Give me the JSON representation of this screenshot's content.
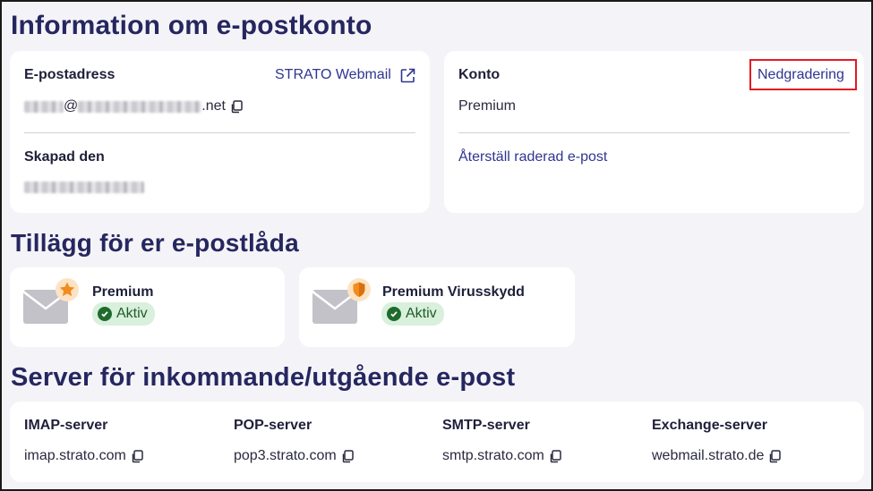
{
  "headings": {
    "account_info": "Information om e-postkonto",
    "addons": "Tillägg för er e-postlåda",
    "servers": "Server för inkommande/utgående e-post"
  },
  "email_card": {
    "email_label": "E-postadress",
    "webmail_link": "STRATO Webmail",
    "email_at": "@",
    "email_domain_suffix": ".net",
    "created_label": "Skapad den"
  },
  "account_card": {
    "account_label": "Konto",
    "downgrade_link": "Nedgradering",
    "plan_value": "Premium",
    "restore_link": "Återställ raderad e-post"
  },
  "addons": [
    {
      "name": "Premium",
      "status": "Aktiv",
      "icon": "star-icon"
    },
    {
      "name": "Premium Virusskydd",
      "status": "Aktiv",
      "icon": "shield-icon"
    }
  ],
  "servers": [
    {
      "label": "IMAP-server",
      "host": "imap.strato.com"
    },
    {
      "label": "POP-server",
      "host": "pop3.strato.com"
    },
    {
      "label": "SMTP-server",
      "host": "smtp.strato.com"
    },
    {
      "label": "Exchange-server",
      "host": "webmail.strato.de"
    }
  ],
  "colors": {
    "heading": "#262660",
    "link": "#2f3590",
    "badge_bg": "#d9f0dc",
    "badge_fg": "#1e5b2a",
    "highlight": "#e21b23",
    "addon_accent": "#f28c1e"
  }
}
